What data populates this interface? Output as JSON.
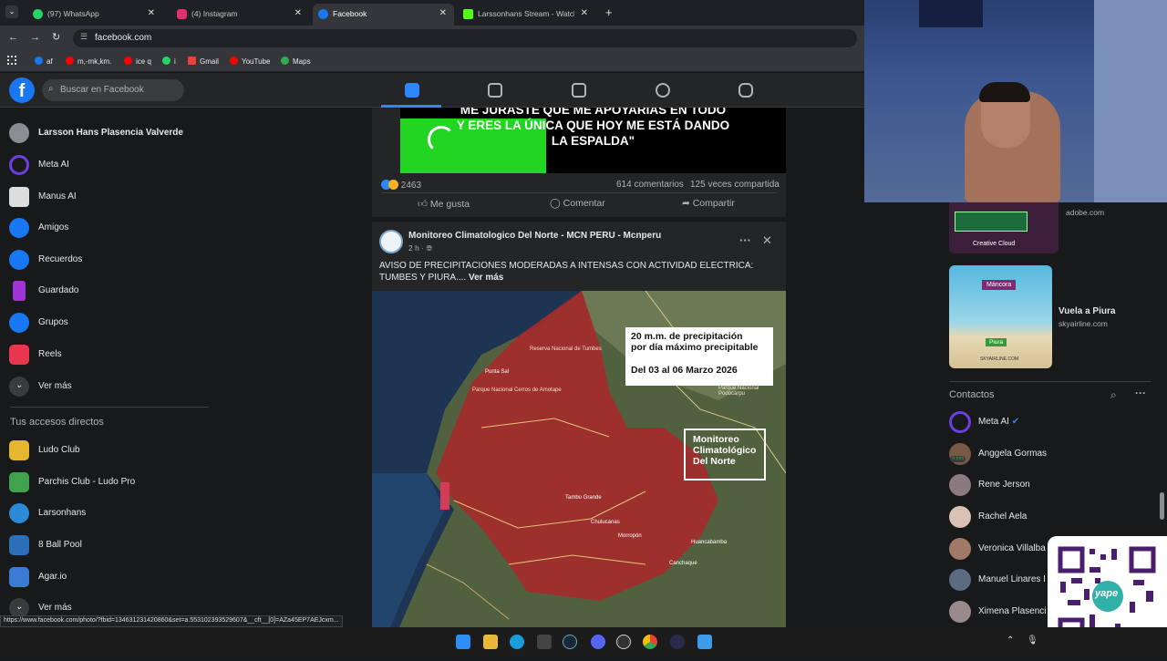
{
  "browser": {
    "tabs": [
      {
        "label": "(97) WhatsApp",
        "color": "#25d366"
      },
      {
        "label": "(4) Instagram",
        "color": "#e1306c"
      },
      {
        "label": "Facebook",
        "color": "#1877f2"
      },
      {
        "label": "Larssonhans Stream - Watch Liv",
        "color": "#53fc18"
      }
    ],
    "url": "facebook.com",
    "bookmarks": [
      "af",
      "m,-mk,km.",
      "ice q",
      "i",
      "Gmail",
      "YouTube",
      "Maps"
    ],
    "status_url": "https://www.facebook.com/photo/?fbid=134631231420860&set=a.553102393529607&__cft__[0]=AZa45EP7AEJcxm..."
  },
  "fb": {
    "logo": "f",
    "search_placeholder": "Buscar en Facebook"
  },
  "sidebar": {
    "items": [
      {
        "label": "Larsson Hans Plasencia Valverde",
        "color": "#8a8d91"
      },
      {
        "label": "Meta AI",
        "color": "#6b3fe0"
      },
      {
        "label": "Manus AI",
        "color": "#dddddd"
      },
      {
        "label": "Amigos",
        "color": "#1877f2"
      },
      {
        "label": "Recuerdos",
        "color": "#1877f2"
      },
      {
        "label": "Guardado",
        "color": "#a033d6"
      },
      {
        "label": "Grupos",
        "color": "#1877f2"
      },
      {
        "label": "Reels",
        "color": "#e8364f"
      },
      {
        "label": "Ver más",
        "color": "#3a3b3c"
      }
    ],
    "shortcuts_title": "Tus accesos directos",
    "shortcuts": [
      {
        "label": "Ludo Club",
        "color": "#e5b630"
      },
      {
        "label": "Parchis Club - Ludo Pro",
        "color": "#3fa34d"
      },
      {
        "label": "Larsonhans",
        "color": "#2b8bd9"
      },
      {
        "label": "8 Ball Pool",
        "color": "#2a6fb8"
      },
      {
        "label": "Agar.io",
        "color": "#3b7bd4"
      },
      {
        "label": "Ver más",
        "color": "#3a3b3c"
      }
    ]
  },
  "post1": {
    "image_text": "ME JURASTE QUE ME APOYARÍAS EN TODO Y ERES LA ÚNICA QUE HOY ME ESTÁ DANDO LA ESPALDA\"",
    "reactions": "2463",
    "comments": "614 comentarios",
    "shares": "125 veces compartida",
    "actions": [
      "Me gusta",
      "Comentar",
      "Compartir"
    ]
  },
  "post2": {
    "page_name": "Monitoreo Climatologico Del Norte - MCN PERU - Mcnperu",
    "time": "2 h ·",
    "text": "AVISO DE PRECIPITACIONES MODERADAS A INTENSAS CON ACTIVIDAD ELECTRICA: TUMBES Y PIURA....",
    "see_more": "Ver más",
    "map_callout_lines": [
      "20 m.m. de precipitación",
      "por día máximo precipitable",
      "Del 03 al 06 Marzo 2026"
    ],
    "map_logo_lines": [
      "Monitoreo",
      "Climatológico",
      "Del Norte"
    ],
    "map_places": [
      "Reserva Nacional de Tumbes",
      "Punta Sal",
      "Parque Nacional Cerros de Amotape",
      "Parque Nacional Podocarpu",
      "Tambo Grande",
      "Chulucanas",
      "Morropón",
      "Huancabamba",
      "Canchaque"
    ]
  },
  "ads": [
    {
      "title": "",
      "domain": "adobe.com",
      "badge": "Creative Cloud",
      "color": "#3b1f3a"
    },
    {
      "title": "Vuela a Piura",
      "domain": "skyairline.com",
      "badge": "Máncora",
      "badge2": "Piura",
      "badge3": "SKYAIRLINE.COM",
      "color": "#2fa9c9"
    }
  ],
  "contacts": {
    "title": "Contactos",
    "items": [
      {
        "name": "Meta AI",
        "color": "#6b3fe0",
        "verified": true,
        "note": ""
      },
      {
        "name": "Anggela Gormas",
        "color": "#7a5a44",
        "note": "4 min"
      },
      {
        "name": "Rene Jerson",
        "color": "#8a7a80",
        "note": ""
      },
      {
        "name": "Rachel Aela",
        "color": "#d9c2b3",
        "note": ""
      },
      {
        "name": "Veronica Villalba",
        "color": "#a07a66",
        "note": ""
      },
      {
        "name": "Manuel Linares I",
        "color": "#5b6b80",
        "note": ""
      },
      {
        "name": "Ximena Plasenci",
        "color": "#9a8a8e",
        "note": ""
      }
    ]
  },
  "qr_brand": "yape",
  "accent": "#1877f2"
}
